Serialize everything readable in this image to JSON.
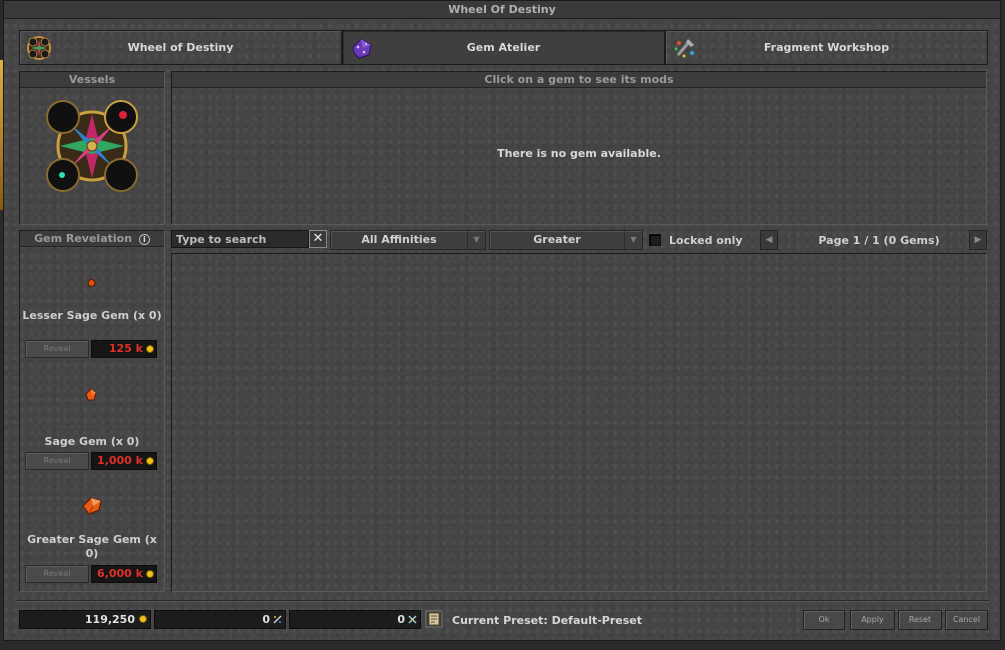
{
  "window": {
    "title": "Wheel Of Destiny"
  },
  "tabs": [
    {
      "label": "Wheel of Destiny",
      "icon": "wheel-icon",
      "active": false
    },
    {
      "label": "Gem Atelier",
      "icon": "gem-atelier-icon",
      "active": true
    },
    {
      "label": "Fragment Workshop",
      "icon": "fragment-workshop-icon",
      "active": false
    }
  ],
  "vessels": {
    "title": "Vessels"
  },
  "gem_details": {
    "title": "Click on a gem to see its mods",
    "empty_message": "There is no gem available."
  },
  "revelation": {
    "title": "Gem Revelation",
    "info_icon": "info-icon",
    "gems": [
      {
        "name": "Lesser Sage Gem (x 0)",
        "button": "Reveal",
        "price": "125 k"
      },
      {
        "name": "Sage Gem (x 0)",
        "button": "Reveal",
        "price": "1,000 k"
      },
      {
        "name": "Greater Sage Gem (x 0)",
        "button": "Reveal",
        "price": "6,000 k"
      }
    ]
  },
  "filters": {
    "search_placeholder": "Type to search",
    "clear_symbol": "✕",
    "affinity": "All Affinities",
    "quality": "Greater",
    "locked_only_label": "Locked only",
    "page_label": "Page 1 / 1 (0 Gems)",
    "prev_symbol": "◀",
    "next_symbol": "▶"
  },
  "footer": {
    "gold": "119,250",
    "lesser_fragments": "0",
    "greater_fragments": "0",
    "preset_label": "Current Preset: Default-Preset",
    "buttons": {
      "ok": "Ok",
      "apply": "Apply",
      "reset": "Reset",
      "cancel": "Cancel"
    }
  },
  "colors": {
    "price_red": "#e0302a",
    "gold_coin": "#f0c020",
    "text": "#d0d0d0"
  }
}
